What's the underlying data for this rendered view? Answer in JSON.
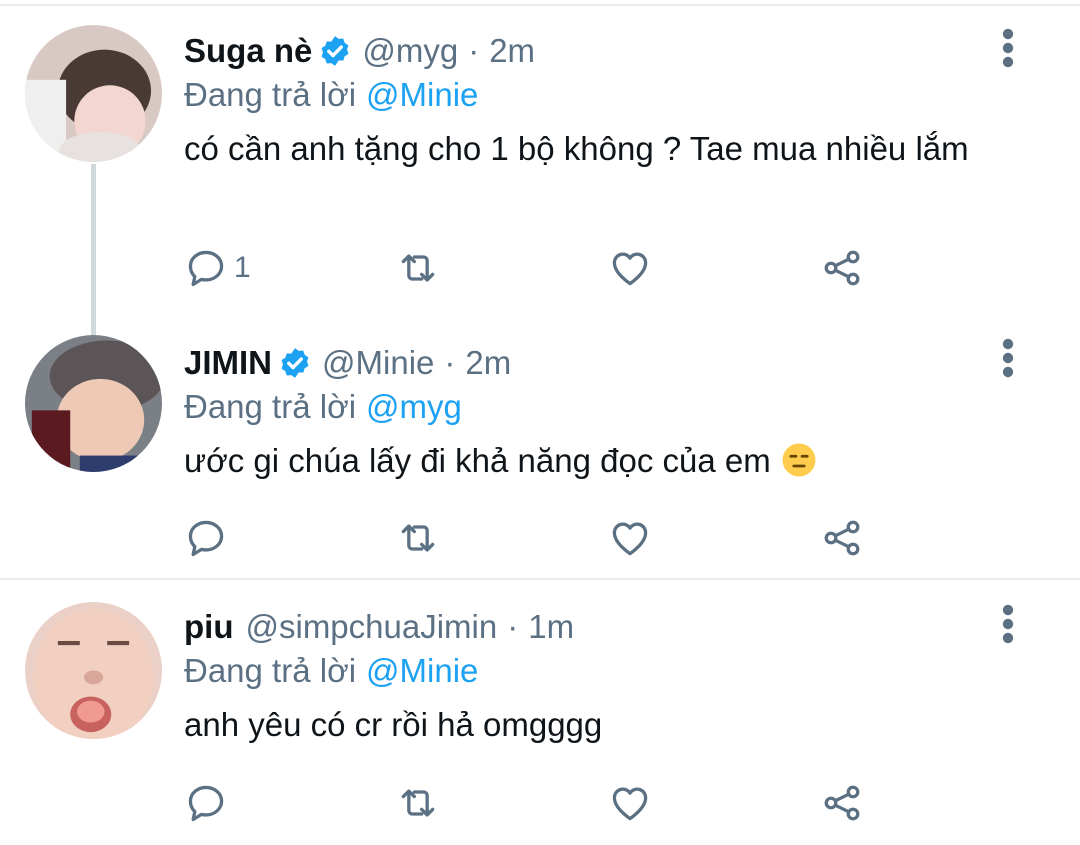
{
  "colors": {
    "accent": "#1da1f2",
    "secondary_text": "#5b7083",
    "primary_text": "#0f1419",
    "divider": "#e6ecf0"
  },
  "tweets": [
    {
      "name": "Suga nè",
      "verified": true,
      "handle": "@myg",
      "separator": "·",
      "time": "2m",
      "reply_prefix": "Đang trả lời",
      "reply_to": "@Minie",
      "text": "có cần anh tặng cho 1 bộ không ? Tae mua nhiều lắm",
      "reply_count": "1"
    },
    {
      "name": "JIMIN",
      "verified": true,
      "handle": "@Minie",
      "separator": "·",
      "time": "2m",
      "reply_prefix": "Đang trả lời",
      "reply_to": "@myg",
      "text": "ước gi chúa lấy đi khả năng đọc của em",
      "emoji": "expressionless-face-emoji"
    },
    {
      "name": "piu",
      "verified": false,
      "handle": "@simpchuaJimin",
      "separator": "·",
      "time": "1m",
      "reply_prefix": "Đang trả lời",
      "reply_to": "@Minie",
      "text": "anh yêu có cr rồi hả omgggg"
    }
  ],
  "icons": [
    "reply-icon",
    "retweet-icon",
    "like-icon",
    "share-icon",
    "more-options-icon",
    "verified-badge-icon"
  ]
}
